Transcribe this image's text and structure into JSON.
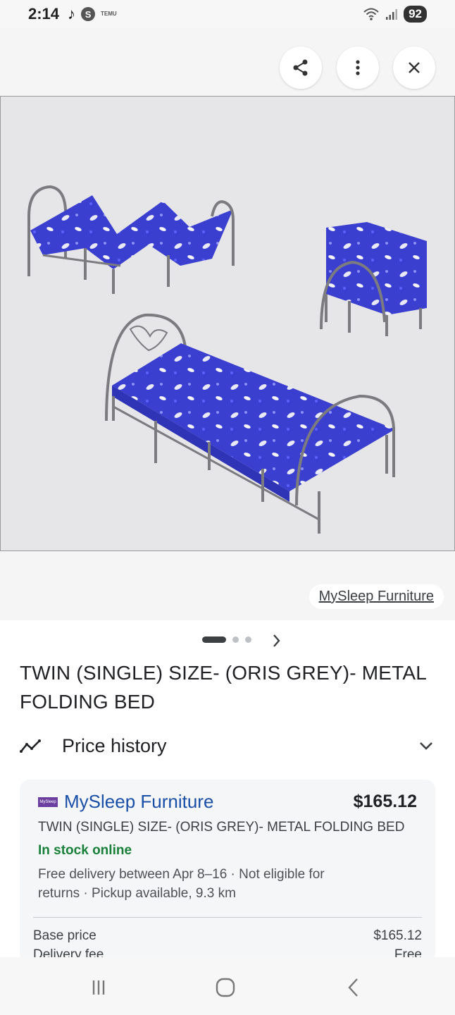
{
  "status_bar": {
    "time": "2:14",
    "s_icon_label": "S",
    "temu_label": "TEMU",
    "battery": "92",
    "icons": [
      "tiktok-icon",
      "s-app-icon",
      "temu-icon",
      "wifi-icon",
      "signal-icon",
      "battery-icon"
    ]
  },
  "toolbar": {
    "share_icon": "share-icon",
    "more_icon": "more-vertical-icon",
    "close_icon": "close-icon"
  },
  "image": {
    "source_label": "MySleep Furniture",
    "pager_count": 3,
    "pager_active": 0
  },
  "product": {
    "title": "TWIN (SINGLE) SIZE- (ORIS GREY)- METAL FOLDING BED"
  },
  "price_history": {
    "label": "Price history"
  },
  "offer": {
    "seller": "MySleep Furniture",
    "seller_logo_text": "MySleep",
    "price": "$165.12",
    "title": "TWIN (SINGLE) SIZE- (ORIS GREY)- METAL FOLDING BED",
    "stock": "In stock online",
    "delivery": "Free delivery between Apr 8–16 · Not eligible for returns · Pickup available, 9.3 km",
    "rows": [
      {
        "label": "Base price",
        "value": "$165.12"
      },
      {
        "label": "Delivery fee",
        "value": "Free"
      }
    ]
  },
  "colors": {
    "seller_link": "#1a4fa8",
    "stock_green": "#188038",
    "mattress_blue": "#3b3fd0",
    "frame_grey": "#7b7b80"
  }
}
